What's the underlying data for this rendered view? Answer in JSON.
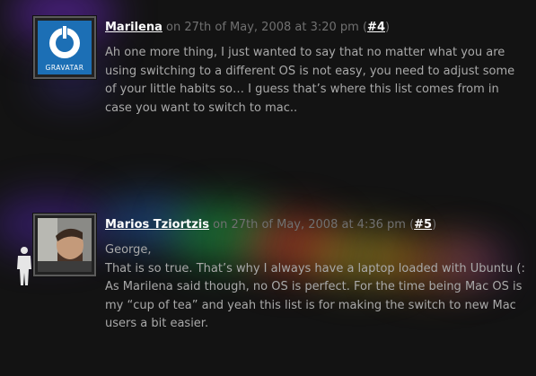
{
  "comments": [
    {
      "author": "Marilena",
      "date_text": "on 27th of May, 2008 at 3:20 pm",
      "number": "#4",
      "avatar_label": "GRAVATAR",
      "paragraphs": [
        "Ah one more thing, I just wanted to say that no matter what you are using switching to a different OS is not easy, you need to adjust some of your little habits so… I guess that’s where this list comes from in case you want to switch to mac.."
      ]
    },
    {
      "author": "Marios Tziortzis",
      "date_text": "on 27th of May, 2008 at 4:36 pm",
      "number": "#5",
      "paragraphs": [
        "George,",
        "That is so true. That’s why I always have a laptop loaded with Ubuntu (:",
        "As Marilena said though, no OS is perfect. For the time being Mac OS is my “cup of tea” and yeah this list is for making the switch to new Mac users a bit easier."
      ]
    }
  ],
  "colors": {
    "background": "#131313",
    "author_link": "#ffffff",
    "meta_text": "#707070",
    "body_text": "#a9a9a9",
    "gravatar_blue": "#1c6fb5"
  },
  "icons": [
    "gravatar-icon",
    "user-photo",
    "person-silhouette-icon"
  ]
}
